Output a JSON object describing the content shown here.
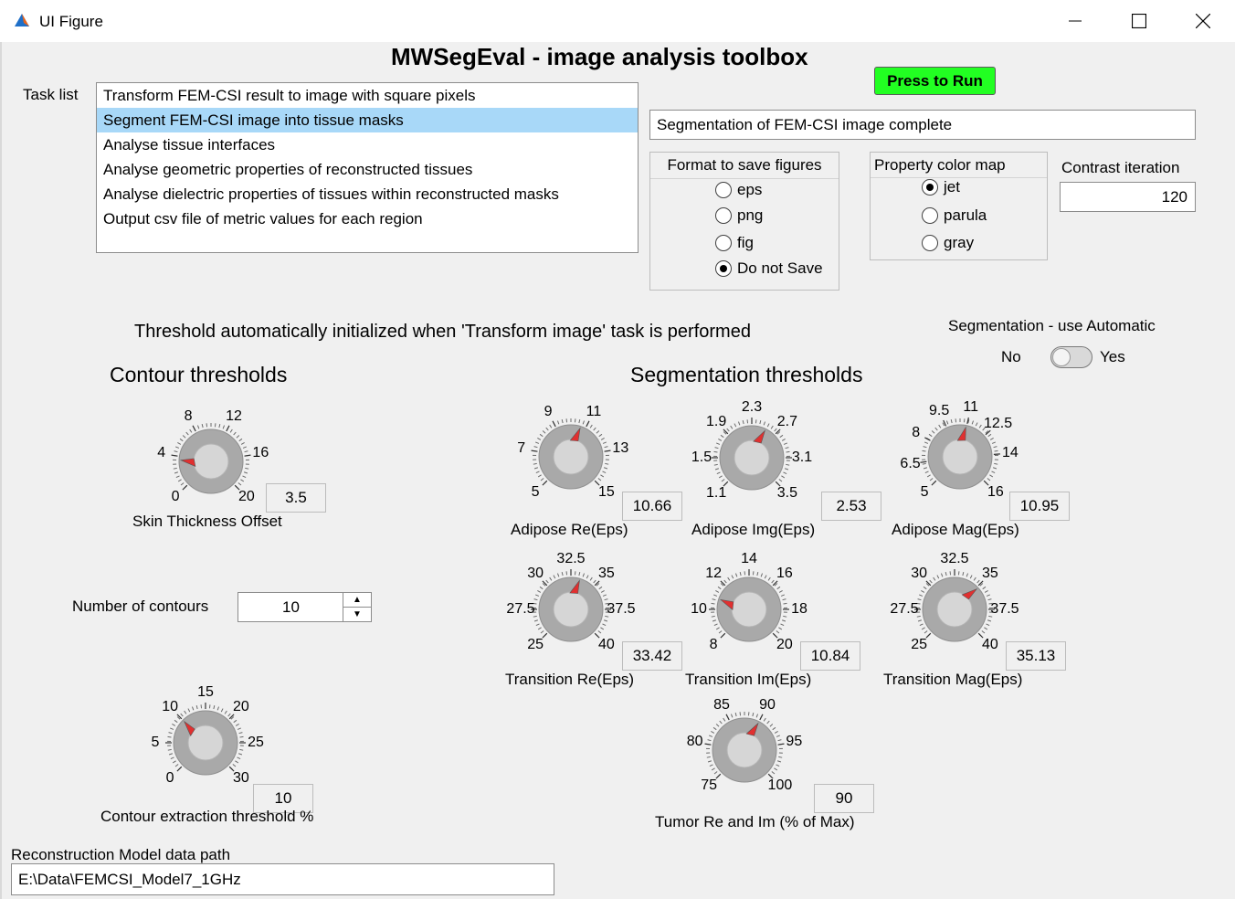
{
  "window": {
    "title": "UI Figure",
    "icon": "matlab-icon",
    "controls": [
      "minimize-icon",
      "maximize-icon",
      "close-icon"
    ]
  },
  "main": {
    "title": "MWSegEval - image analysis toolbox",
    "run_button": "Press to Run",
    "status": "Segmentation of FEM-CSI image complete"
  },
  "task_list": {
    "label": "Task list",
    "items": [
      "Transform FEM-CSI result to image with square pixels",
      "Segment FEM-CSI image into tissue masks",
      "Analyse tissue interfaces",
      "Analyse geometric properties of reconstructed tissues",
      "Analyse dielectric properties of tissues within reconstructed masks",
      "Output csv file of metric values for each region"
    ],
    "selected": "Segment FEM-CSI image into tissue masks"
  },
  "format_group": {
    "title": "Format to save figures",
    "options": [
      "eps",
      "png",
      "fig",
      "Do not Save"
    ],
    "selected": "Do not Save"
  },
  "colormap_group": {
    "title": "Property color map",
    "options": [
      "jet",
      "parula",
      "gray"
    ],
    "selected": "jet"
  },
  "contrast": {
    "label": "Contrast iteration",
    "value": "120"
  },
  "threshold_note": "Threshold automatically initialized when 'Transform image' task is performed",
  "segmentation_switch": {
    "label": "Segmentation - use Automatic",
    "off_label": "No",
    "on_label": "Yes",
    "state": "No"
  },
  "sections": {
    "contour": "Contour thresholds",
    "segmentation": "Segmentation thresholds"
  },
  "number_of_contours": {
    "label": "Number of contours",
    "value": "10"
  },
  "data_path": {
    "label": "Reconstruction Model data path",
    "value": "E:\\Data\\FEMCSI_Model7_1GHz"
  },
  "knobs": [
    {
      "id": "skin",
      "label": "Skin Thickness Offset",
      "min": 0,
      "max": 20,
      "ticks": [
        "0",
        "4",
        "8",
        "12",
        "16",
        "20"
      ],
      "value": "3.5"
    },
    {
      "id": "contour-thr",
      "label": "Contour extraction threshold %",
      "min": 0,
      "max": 30,
      "ticks": [
        "0",
        "5",
        "10",
        "15",
        "20",
        "25",
        "30"
      ],
      "value": "10"
    },
    {
      "id": "adipose-re",
      "label": "Adipose Re(Eps)",
      "min": 5,
      "max": 15,
      "ticks": [
        "5",
        "7",
        "9",
        "11",
        "13",
        "15"
      ],
      "value": "10.66"
    },
    {
      "id": "adipose-img",
      "label": "Adipose Img(Eps)",
      "min": 1.1,
      "max": 3.5,
      "ticks": [
        "1.1",
        "1.5",
        "1.9",
        "2.3",
        "2.7",
        "3.1",
        "3.5"
      ],
      "value": "2.53"
    },
    {
      "id": "adipose-mag",
      "label": "Adipose Mag(Eps)",
      "min": 5,
      "max": 16,
      "ticks": [
        "5",
        "6.5",
        "8",
        "9.5",
        "11",
        "12.5",
        "14",
        "16"
      ],
      "value": "10.95"
    },
    {
      "id": "transition-re",
      "label": "Transition Re(Eps)",
      "min": 25,
      "max": 40,
      "ticks": [
        "25",
        "27.5",
        "30",
        "32.5",
        "35",
        "37.5",
        "40"
      ],
      "value": "33.42"
    },
    {
      "id": "transition-im",
      "label": "Transition Im(Eps)",
      "min": 8,
      "max": 20,
      "ticks": [
        "8",
        "10",
        "12",
        "14",
        "16",
        "18",
        "20"
      ],
      "value": "10.84"
    },
    {
      "id": "transition-mag",
      "label": "Transition Mag(Eps)",
      "min": 25,
      "max": 40,
      "ticks": [
        "25",
        "27.5",
        "30",
        "32.5",
        "35",
        "37.5",
        "40"
      ],
      "value": "35.13"
    },
    {
      "id": "tumor",
      "label": "Tumor Re and Im (% of Max)",
      "min": 75,
      "max": 100,
      "ticks": [
        "75",
        "80",
        "85",
        "90",
        "95",
        "100"
      ],
      "value": "90"
    }
  ]
}
